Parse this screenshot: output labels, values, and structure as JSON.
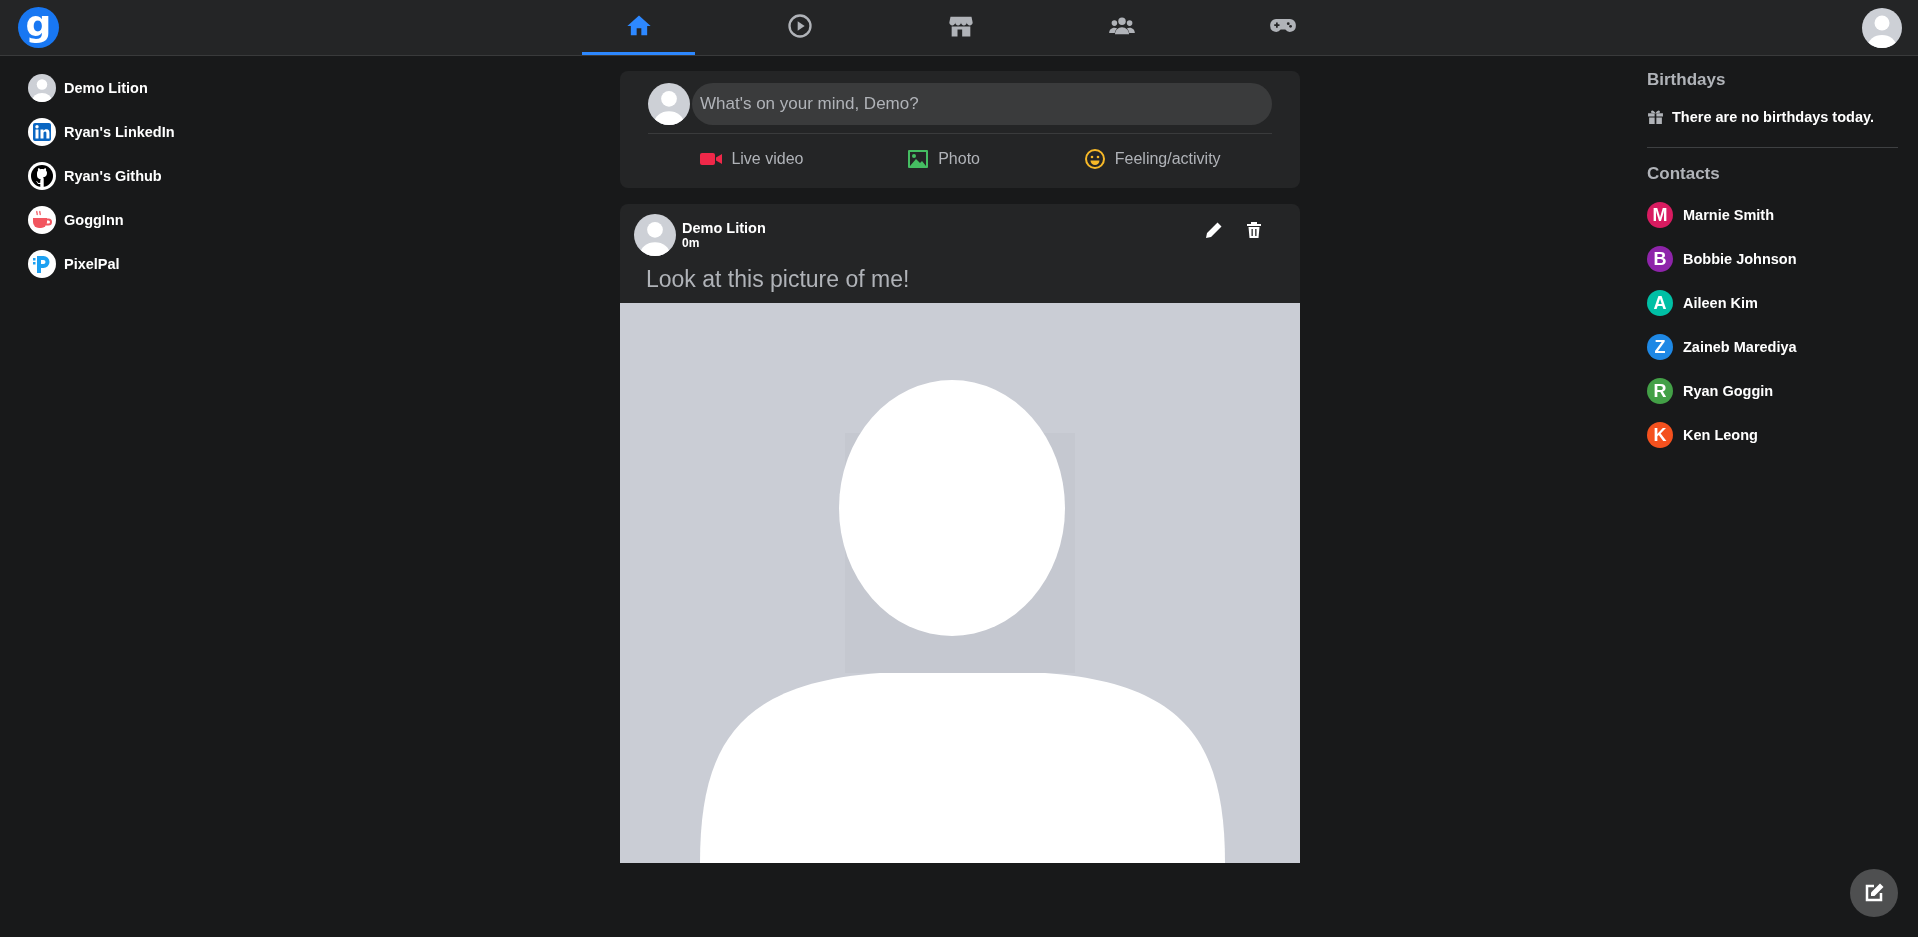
{
  "nav": {
    "logo": "g",
    "tabs": [
      {
        "selected": true
      },
      {
        "selected": false
      },
      {
        "selected": false
      },
      {
        "selected": false
      },
      {
        "selected": false
      }
    ]
  },
  "sidebar": {
    "items": [
      {
        "label": "Demo Lition"
      },
      {
        "label": "Ryan's LinkedIn"
      },
      {
        "label": "Ryan's Github"
      },
      {
        "label": "GoggInn"
      },
      {
        "label": "PixelPal"
      }
    ]
  },
  "composer": {
    "placeholder": "What's on your mind, Demo?",
    "actions": [
      {
        "label": "Live video"
      },
      {
        "label": "Photo"
      },
      {
        "label": "Feeling/activity"
      }
    ]
  },
  "post": {
    "author": "Demo Lition",
    "time": "0m",
    "text": "Look at this picture of me!"
  },
  "birthdays": {
    "title": "Birthdays",
    "text": "There are no birthdays today."
  },
  "contacts": {
    "title": "Contacts",
    "items": [
      {
        "initial": "M",
        "name": "Marnie Smith",
        "color": "#d81b60"
      },
      {
        "initial": "B",
        "name": "Bobbie Johnson",
        "color": "#8e24aa"
      },
      {
        "initial": "A",
        "name": "Aileen Kim",
        "color": "#00bfa5"
      },
      {
        "initial": "Z",
        "name": "Zaineb Marediya",
        "color": "#1e88e5"
      },
      {
        "initial": "R",
        "name": "Ryan Goggin",
        "color": "#43a047"
      },
      {
        "initial": "K",
        "name": "Ken Leong",
        "color": "#f4511e"
      }
    ]
  }
}
